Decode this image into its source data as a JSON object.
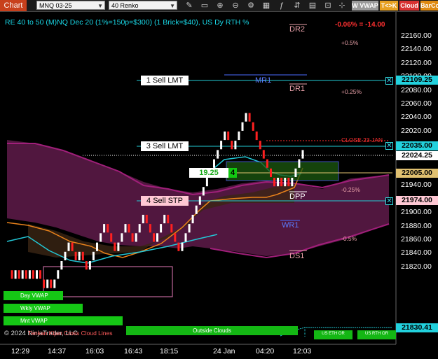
{
  "toolbar": {
    "app_label": "Chart",
    "instrument": "MNQ 03-25",
    "interval": "40 Renko",
    "icons": [
      "draw-tools-icon",
      "zoom-in-icon",
      "zoom-out-icon",
      "properties-icon",
      "strategy-icon",
      "indicator-icon",
      "cascade-icon",
      "cursor-icon"
    ],
    "vwap_btn": "W VWAP",
    "tk_btn": "T<>K",
    "cloud_btn": "Cloud",
    "barco_btn": "BarCo"
  },
  "header": {
    "info": "RE 40 to 50 (M)NQ Dec 20 (1%=150p=$300) (1 Brick=$40), US Dy RTH %",
    "pnl": "-0.06% = -14.00"
  },
  "colors": {
    "accent_cyan": "#19d7e6",
    "pivot_pink": "#e8a0a8",
    "pivot_blue": "#7b8cff",
    "vwap_green": "#15c715",
    "up_brick": "#ffffff",
    "down_brick": "#ff2020",
    "cloud": "#5a1a46"
  },
  "pivots": {
    "dr2": "DR2",
    "r1_pct_label": "+0.5%",
    "mr1": "MR1",
    "dr1": "DR1",
    "r1b_pct_label": "+0.25%",
    "close_label": "CLOSE 23 JAN",
    "dpp": "DPP",
    "s_pct1": "-0.25%",
    "wr1": "WR1",
    "s_pct2": "-0.5%",
    "ds1": "DS1"
  },
  "orders": {
    "sell1": "1 Sell LMT",
    "sell3": "3 Sell LMT",
    "sell4": "4 Sell STP",
    "position_pnl": "19.25",
    "position_qty": "4"
  },
  "price_labels": {
    "p1": "22109.25",
    "p2": "22035.00",
    "p3": "22024.25",
    "p4": "22005.00",
    "p5": "21974.00",
    "p6": "21830.41"
  },
  "yaxis": [
    "22160.00",
    "22140.00",
    "22120.00",
    "22100.00",
    "22080.00",
    "22060.00",
    "22040.00",
    "22020.00",
    "22000.00",
    "21980.00",
    "21960.00",
    "21940.00",
    "21920.00",
    "21900.00",
    "21880.00",
    "21860.00",
    "21840.00",
    "21820.00"
  ],
  "xaxis": [
    "12:29",
    "14:37",
    "16:03",
    "16:43",
    "18:15",
    "24 Jan",
    "04:20",
    "12:03"
  ],
  "vwaps": {
    "day": "Day VWAP",
    "wkly": "Wkly VWAP",
    "mnt": "Mnt VWAP",
    "outside_clouds": "Outside Clouds",
    "us_eth": "US ETH OR",
    "us_rth": "US RTH OR"
  },
  "footer": {
    "copyright": "© 2024 NinjaTrader, LLC",
    "overlay_text": "Tenkan Kijun Cross Cloud Lines"
  },
  "chart_data": {
    "type": "renko",
    "brick_size_points": 10,
    "bricks": [
      21895,
      21885,
      21895,
      21885,
      21895,
      21885,
      21895,
      21885,
      21895,
      21885,
      21875,
      21885,
      21875,
      21885,
      21895,
      21905,
      21915,
      21925,
      21915,
      21905,
      21915,
      21905,
      21895,
      21905,
      21915,
      21925,
      21935,
      21945,
      21935,
      21925,
      21915,
      21925,
      21935,
      21945,
      21935,
      21925,
      21935,
      21945,
      21955,
      21945,
      21935,
      21925,
      21935,
      21945,
      21955,
      21945,
      21935,
      21925,
      21915,
      21925,
      21935,
      21945,
      21955,
      21965,
      21975,
      21985,
      21995,
      22005,
      22015,
      22025,
      22035,
      22045,
      22035,
      22025,
      22035,
      22045,
      22055,
      22065,
      22055,
      22045,
      22035,
      22025,
      22015,
      22005,
      21995,
      21985,
      21995,
      21985,
      21995,
      21985,
      21995,
      22005,
      22015,
      22025
    ],
    "ylim": [
      21815,
      22172
    ]
  }
}
